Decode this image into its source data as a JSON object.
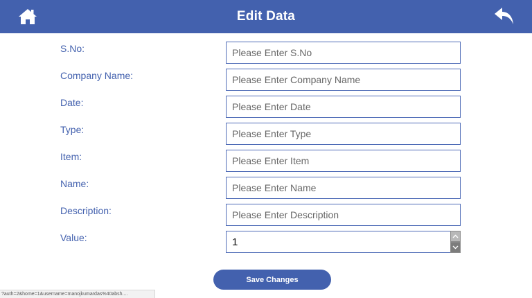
{
  "header": {
    "title": "Edit Data",
    "home_icon": "home-icon",
    "back_icon": "reply-arrow-icon"
  },
  "colors": {
    "accent": "#4361ae",
    "input_border": "#4e6bb7",
    "background": "#ffffff"
  },
  "fields": [
    {
      "label": "S.No:",
      "placeholder": "Please Enter S.No"
    },
    {
      "label": "Company Name:",
      "placeholder": "Please Enter Company Name"
    },
    {
      "label": "Date:",
      "placeholder": "Please Enter Date"
    },
    {
      "label": "Type:",
      "placeholder": "Please Enter Type"
    },
    {
      "label": "Item:",
      "placeholder": "Please Enter Item"
    },
    {
      "label": "Name:",
      "placeholder": "Please Enter Name"
    },
    {
      "label": "Description:",
      "placeholder": "Please Enter Description"
    },
    {
      "label": "Value:",
      "value": "1"
    }
  ],
  "save_label": "Save Changes",
  "status_url": "?auth=2&home=1&username=manojkumardas%40absh...."
}
